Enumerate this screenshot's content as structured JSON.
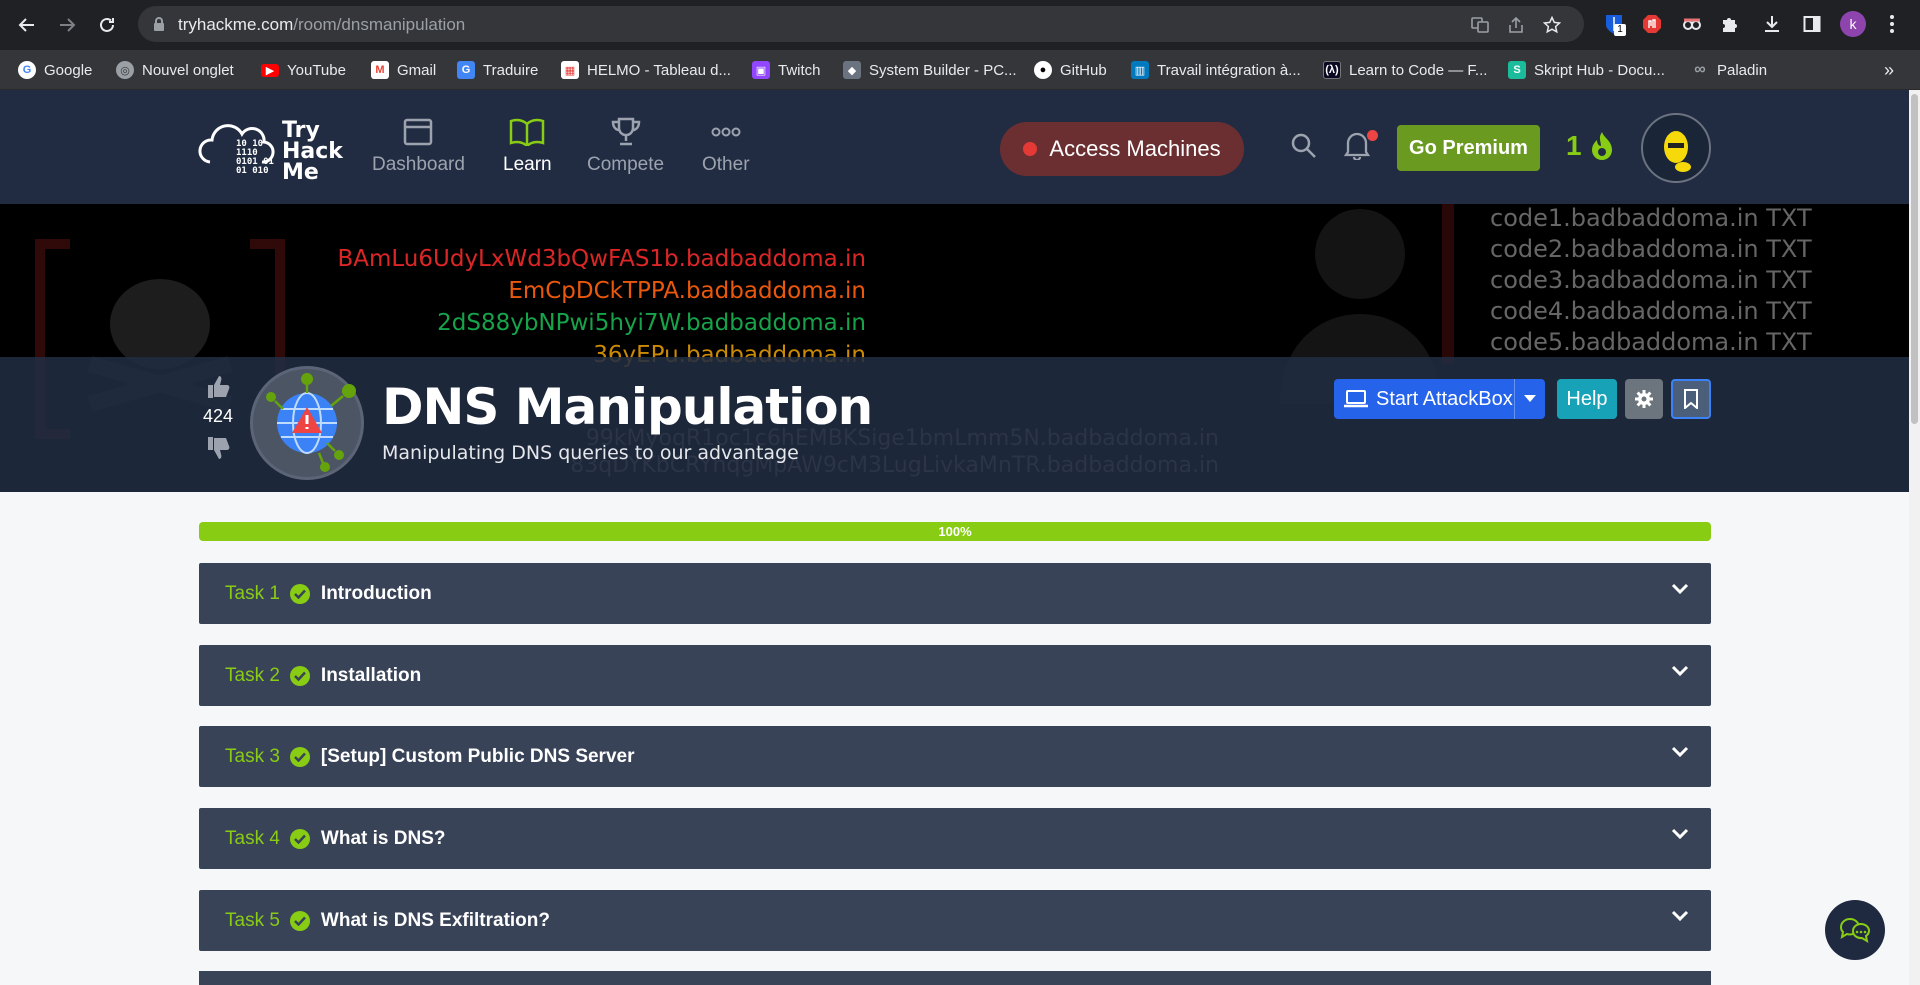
{
  "browser": {
    "url_domain": "tryhackme.com",
    "url_path": "/room/dnsmanipulation",
    "profile_initial": "k",
    "bitwarden_badge": "1"
  },
  "bookmarks": [
    {
      "label": "Google",
      "icon": "google-icon",
      "color": "#ffffff"
    },
    {
      "label": "Nouvel onglet",
      "icon": "globe-icon",
      "color": "#9aa0a6"
    },
    {
      "label": "YouTube",
      "icon": "youtube-icon",
      "color": "#ff0000"
    },
    {
      "label": "Gmail",
      "icon": "gmail-icon",
      "color": "#ea4335"
    },
    {
      "label": "Traduire",
      "icon": "translate-icon",
      "color": "#4285f4"
    },
    {
      "label": "HELMO - Tableau d...",
      "icon": "helmo-icon",
      "color": "#e53935"
    },
    {
      "label": "Twitch",
      "icon": "twitch-icon",
      "color": "#9146ff"
    },
    {
      "label": "System Builder - PC...",
      "icon": "pcpartpicker-icon",
      "color": "#9aa0a6"
    },
    {
      "label": "GitHub",
      "icon": "github-icon",
      "color": "#ffffff"
    },
    {
      "label": "Travail intégration à...",
      "icon": "trello-icon",
      "color": "#0079bf"
    },
    {
      "label": "Learn to Code — F...",
      "icon": "freecodecamp-icon",
      "color": "#0a0a23"
    },
    {
      "label": "Skript Hub - Docu...",
      "icon": "skripthub-icon",
      "color": "#1abc9c"
    },
    {
      "label": "Paladin",
      "icon": "paladin-icon",
      "color": "#9aa0a6"
    }
  ],
  "navbar": {
    "logo_text": [
      "Try",
      "Hack",
      "Me"
    ],
    "logo_bits": [
      "10   10",
      "1110",
      "0101  01",
      "01   010"
    ],
    "items": [
      {
        "label": "Dashboard",
        "active": false
      },
      {
        "label": "Learn",
        "active": true
      },
      {
        "label": "Compete",
        "active": false
      },
      {
        "label": "Other",
        "active": false
      }
    ],
    "access_machines": "Access Machines",
    "go_premium": "Go Premium",
    "streak": "1"
  },
  "hero": {
    "codes": [
      {
        "text": "BAmLu6UdyLxWd3bQwFAS1b.badbaddoma.in",
        "color": "#dc2626"
      },
      {
        "text": "EmCpDCkTPPA.badbaddoma.in",
        "color": "#ea580c"
      },
      {
        "text": "2dS88ybNPwi5hyi7W.badbaddoma.in",
        "color": "#16a34a"
      },
      {
        "text": "36yEPu.badbaddoma.in",
        "color": "#ca8a04"
      }
    ],
    "faint_codes": [
      "99kMyoqR1oc1c6hEMBKSige1bmLmm5N.badbaddoma.in",
      "83qDYKbCRYnqgMpAW9cM3LugLivkaMnTR.badbaddoma.in"
    ],
    "txt_records": [
      "code1.badbaddoma.in TXT",
      "code2.badbaddoma.in TXT",
      "code3.badbaddoma.in TXT",
      "code4.badbaddoma.in TXT",
      "code5.badbaddoma.in TXT"
    ],
    "votes": "424",
    "title": "DNS Manipulation",
    "subtitle": "Manipulating DNS queries to our advantage",
    "start_attackbox": "Start AttackBox",
    "help": "Help"
  },
  "progress": {
    "label": "100%",
    "value": 100
  },
  "tasks": [
    {
      "number": "Task 1",
      "name": "Introduction",
      "completed": true
    },
    {
      "number": "Task 2",
      "name": "Installation",
      "completed": true
    },
    {
      "number": "Task 3",
      "name": "[Setup] Custom Public DNS Server",
      "completed": true
    },
    {
      "number": "Task 4",
      "name": "What is DNS?",
      "completed": true
    },
    {
      "number": "Task 5",
      "name": "What is DNS Exfiltration?",
      "completed": true
    }
  ]
}
